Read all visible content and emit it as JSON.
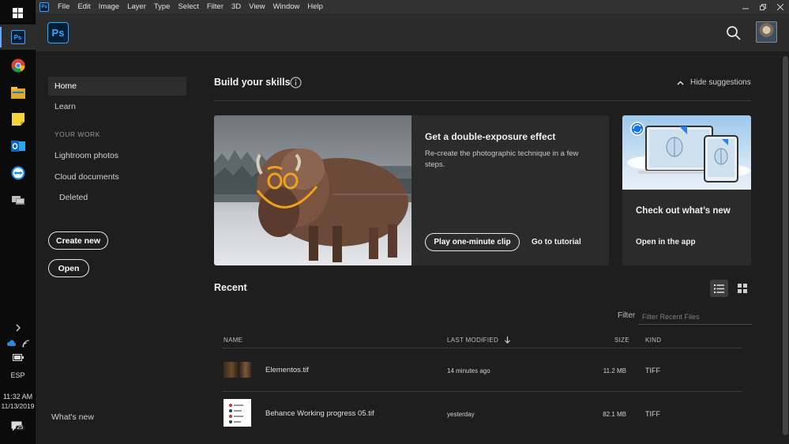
{
  "taskbar": {
    "time": "11:32 AM",
    "date": "11/13/2019",
    "language": "ESP",
    "notification_count": "25",
    "pinned": [
      {
        "name": "photoshop",
        "label": "Ps",
        "color": "#31a8ff"
      },
      {
        "name": "chrome",
        "color": "#e8b23a"
      },
      {
        "name": "file-explorer",
        "color": "#f3c13a"
      },
      {
        "name": "sticky-notes",
        "color": "#f7d53a"
      },
      {
        "name": "outlook",
        "color": "#1a73d6"
      },
      {
        "name": "teamviewer",
        "color": "#0e8ee9"
      },
      {
        "name": "network-app",
        "color": "#9a9a9a"
      }
    ]
  },
  "menubar": {
    "app_icon": "Ps",
    "items": [
      "File",
      "Edit",
      "Image",
      "Layer",
      "Type",
      "Select",
      "Filter",
      "3D",
      "View",
      "Window",
      "Help"
    ]
  },
  "header": {
    "logo": "Ps"
  },
  "nav": {
    "home": "Home",
    "learn": "Learn",
    "section": "YOUR WORK",
    "lightroom": "Lightroom photos",
    "cloud": "Cloud documents",
    "deleted": "Deleted",
    "create_new": "Create new",
    "open": "Open",
    "whats_new": "What's new"
  },
  "skills": {
    "title": "Build your skills",
    "hide": "Hide suggestions",
    "card1": {
      "title": "Get a double-exposure effect",
      "desc": "Re-create the photographic technique in a few steps.",
      "play": "Play one-minute clip",
      "tutorial": "Go to tutorial"
    },
    "card2": {
      "title": "Check out what’s new",
      "link": "Open in the app"
    }
  },
  "recent": {
    "title": "Recent",
    "filter_label": "Filter",
    "filter_placeholder": "Filter Recent Files",
    "columns": {
      "name": "NAME",
      "modified": "LAST MODIFIED",
      "size": "SIZE",
      "kind": "KIND"
    },
    "files": [
      {
        "name": "Elementos.tif",
        "modified": "14 minutes ago",
        "size": "11.2 MB",
        "kind": "TIFF"
      },
      {
        "name": "Behance Working progress 05.tif",
        "modified": "yesterday",
        "size": "82.1 MB",
        "kind": "TIFF"
      }
    ]
  },
  "colors": {
    "accent": "#31a8ff",
    "background": "#1e1e1e",
    "panel": "#2b2b2b"
  }
}
